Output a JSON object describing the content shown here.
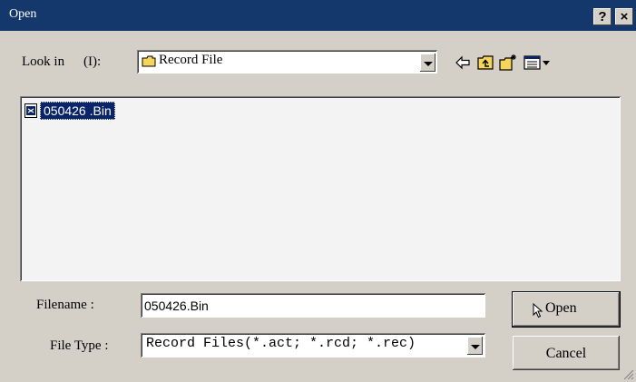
{
  "window": {
    "title": "Open",
    "help_button": "?",
    "close_button": "×"
  },
  "lookin": {
    "label": "Look in",
    "shortcut": "(I):",
    "value": "Record File"
  },
  "toolbar": {
    "back_icon": "back-arrow-icon",
    "up_icon": "up-folder-icon",
    "new_folder_icon": "new-folder-icon",
    "view_icon": "view-menu-icon"
  },
  "files": [
    {
      "name": "050426 .Bin"
    }
  ],
  "filename": {
    "label": "Filename :",
    "value": "050426.Bin"
  },
  "filetype": {
    "label": "File Type :",
    "value": "Record Files(*.act; *.rcd; *.rec)"
  },
  "buttons": {
    "open": "Open",
    "cancel": "Cancel"
  },
  "colors": {
    "titlebar": "#14386b",
    "face": "#d4d0c8",
    "selection": "#0a246a"
  }
}
